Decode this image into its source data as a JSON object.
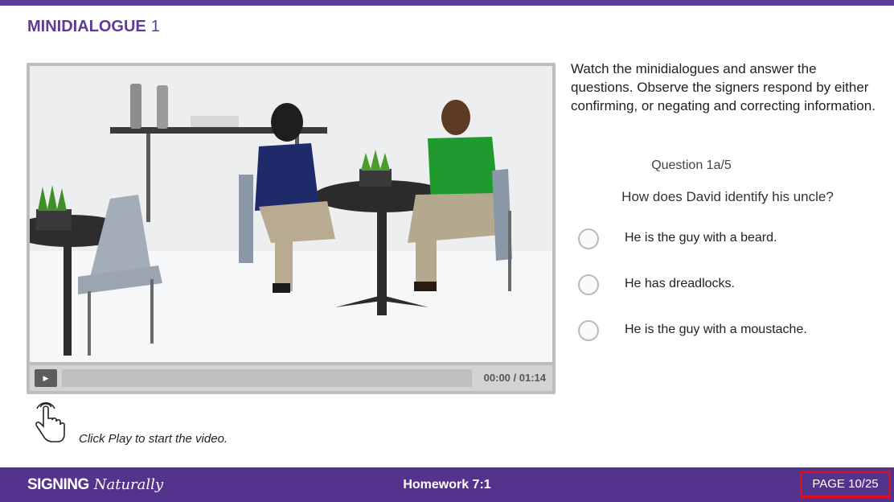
{
  "colors": {
    "accent": "#5b3d96",
    "footer": "#54338d",
    "highlight": "#e0101a"
  },
  "header": {
    "title_bold": "MINIDIALOGUE",
    "title_number": "1"
  },
  "video": {
    "current_time": "00:00",
    "duration": "01:14",
    "play_icon": "play-icon",
    "hint_icon": "pointing-hand-icon",
    "hint_text": "Click Play to start the video."
  },
  "quiz": {
    "instructions": "Watch the minidialogues and answer the questions. Observe the signers respond by either confirming, or negating and correcting information.",
    "question_number": "Question 1a/5",
    "question": "How does David identify his uncle?",
    "options": [
      {
        "label": "He is the guy with a beard."
      },
      {
        "label": "He has dreadlocks."
      },
      {
        "label": "He is the guy with a moustache."
      }
    ]
  },
  "footer": {
    "logo_main": "SIGNING",
    "logo_script": "Naturally",
    "center_text": "Homework 7:1",
    "page": "PAGE 10/25"
  }
}
